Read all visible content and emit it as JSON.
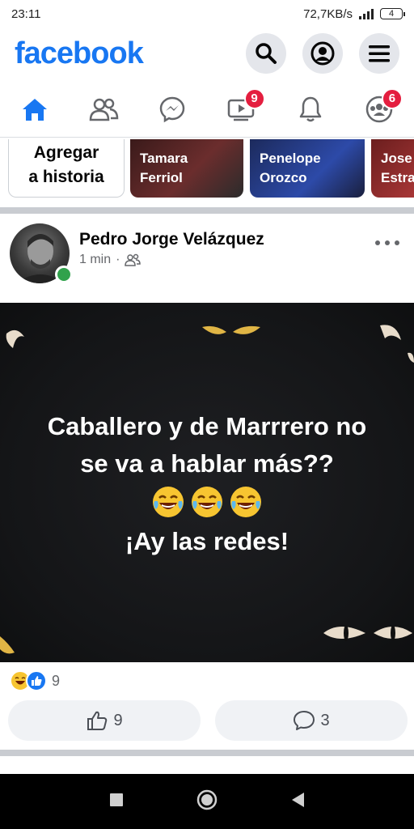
{
  "status_bar": {
    "time": "23:11",
    "net_speed": "72,7KB/s",
    "battery_level": "4"
  },
  "header": {
    "logo_text": "facebook",
    "brand_color": "#1877f2"
  },
  "tabs": [
    {
      "name": "home",
      "icon": "home-icon",
      "badge": ""
    },
    {
      "name": "friends",
      "icon": "friends-icon",
      "badge": ""
    },
    {
      "name": "messenger",
      "icon": "messenger-icon",
      "badge": ""
    },
    {
      "name": "watch",
      "icon": "video-icon",
      "badge": "9"
    },
    {
      "name": "notifications",
      "icon": "bell-icon",
      "badge": ""
    },
    {
      "name": "groups",
      "icon": "groups-icon",
      "badge": "6"
    }
  ],
  "stories": {
    "add_line1": "Agregar",
    "add_line2": "a historia",
    "items": [
      {
        "line1": "Tamara",
        "line2": "Ferriol"
      },
      {
        "line1": "Penelope",
        "line2": "Orozco"
      },
      {
        "line1": "Jose",
        "line2": "Estra"
      }
    ]
  },
  "post": {
    "author": "Pedro Jorge Velázquez",
    "time": "1 min",
    "dot": "·",
    "image_text_line1": "Caballero y de  Marrrero no",
    "image_text_line2": "se va a hablar más??",
    "image_text_line3": "¡Ay las redes!",
    "reaction_count": "9",
    "like_count": "9",
    "comment_count": "3"
  }
}
